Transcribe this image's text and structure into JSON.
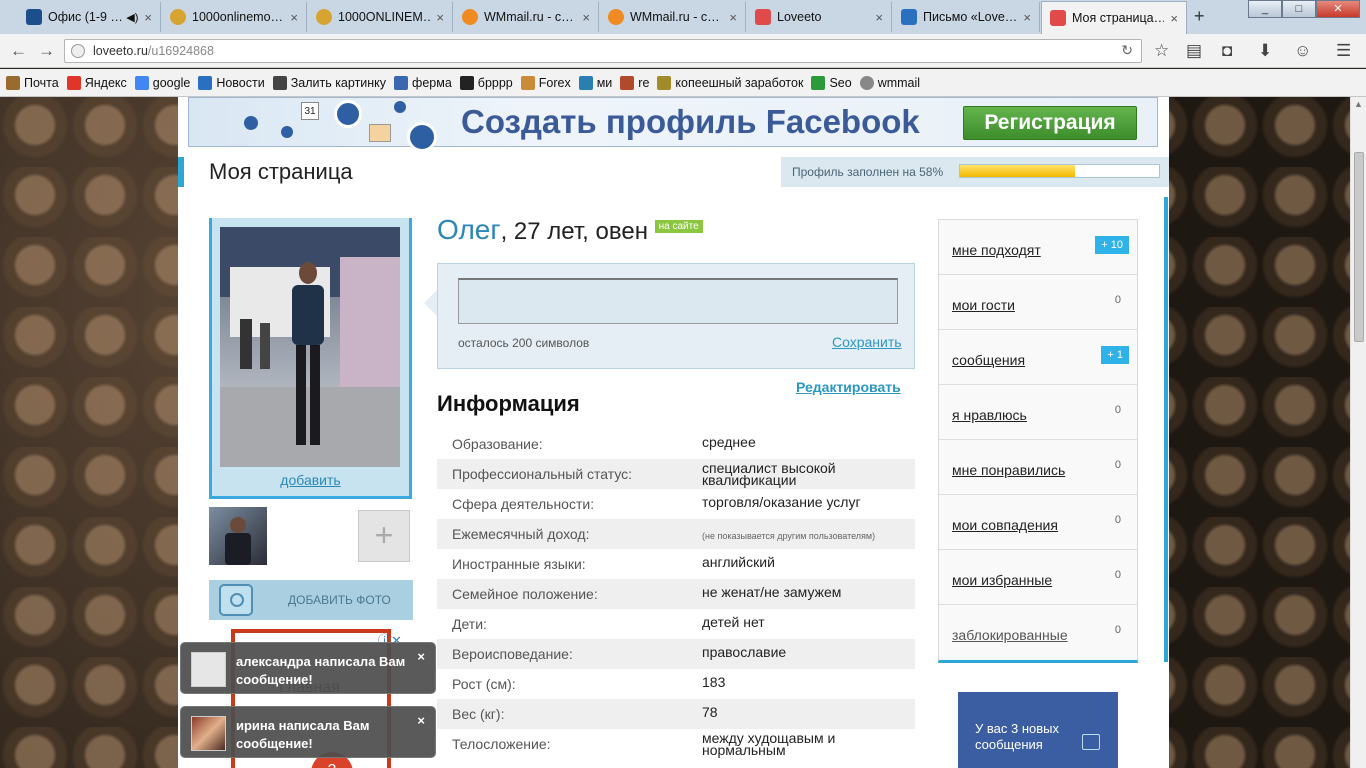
{
  "browser": {
    "tabs": [
      {
        "title": "Офис (1-9 …",
        "favicon_color": "#1b4f8c"
      },
      {
        "title": "1000onlinemo…",
        "favicon_color": "#d8a431"
      },
      {
        "title": "1000ONLINEM…",
        "favicon_color": "#d8a431"
      },
      {
        "title": "WMmail.ru - с…",
        "favicon_color": "#f08a22"
      },
      {
        "title": "WMmail.ru - с…",
        "favicon_color": "#f08a22"
      },
      {
        "title": "Loveeto",
        "favicon_color": "#e04a4a"
      },
      {
        "title": "Письмо «Love…",
        "favicon_color": "#2a6fc0"
      },
      {
        "title": "Моя страница…",
        "favicon_color": "#e04a4a"
      }
    ],
    "close_glyph": "×",
    "new_tab_glyph": "+",
    "url_host": "loveeto.ru",
    "url_path": "/u16924868",
    "bookmarks": [
      {
        "label": "Почта",
        "color": "#9a6b2f"
      },
      {
        "label": "Яндекс",
        "color": "#e0352b"
      },
      {
        "label": "google",
        "color": "#4285f4"
      },
      {
        "label": "Новости",
        "color": "#2a6fc0"
      },
      {
        "label": "Залить картинку",
        "color": "#444"
      },
      {
        "label": "ферма",
        "color": "#3a67b0"
      },
      {
        "label": "брррр",
        "color": "#222"
      },
      {
        "label": "Forex",
        "color": "#c98a3a"
      },
      {
        "label": "ми",
        "color": "#2b7fb0"
      },
      {
        "label": "re",
        "color": "#b04a2a"
      },
      {
        "label": "копеешный заработок",
        "color": "#a28b2a"
      },
      {
        "label": "Seo",
        "color": "#2d9a3a"
      },
      {
        "label": "wmmail",
        "color": "#888"
      }
    ],
    "icons": [
      "back-icon",
      "forward-icon",
      "reload-icon",
      "bookmark-star-icon",
      "reading-list-icon",
      "pocket-icon",
      "download-icon",
      "hello-icon",
      "menu-icon"
    ]
  },
  "ad": {
    "title": "Создать профиль Facebook",
    "button": "Регистрация",
    "calendar_day": "31"
  },
  "page": {
    "title": "Моя страница",
    "profile_filled_label": "Профиль заполнен на 58%",
    "profile_filled_fraction": 0.58
  },
  "left": {
    "add_link": "добавить",
    "add_photo": "ДОБАВИТЬ ФОТО",
    "plus_glyph": "+"
  },
  "user": {
    "name": "Олег",
    "rest": ", 27 лет, овен",
    "online": "на сайте"
  },
  "status": {
    "chars_left": "осталось 200 символов",
    "save": "Сохранить"
  },
  "info": {
    "edit": "Редактировать",
    "header": "Информация",
    "rows": [
      {
        "k": "Образование:",
        "v": "среднее"
      },
      {
        "k": "Профессиональный статус:",
        "v": "специалист высокой квалификации"
      },
      {
        "k": "Сфера деятельности:",
        "v": "торговля/оказание услуг"
      },
      {
        "k": "Ежемесячный доход:",
        "v": "(не показывается другим пользователям)"
      },
      {
        "k": "Иностранные языки:",
        "v": "английский"
      },
      {
        "k": "Семейное положение:",
        "v": "не женат/не замужем"
      },
      {
        "k": "Дети:",
        "v": "детей нет"
      },
      {
        "k": "Вероисповедание:",
        "v": "православие"
      },
      {
        "k": "Рост (см):",
        "v": "183"
      },
      {
        "k": "Вес (кг):",
        "v": "78"
      },
      {
        "k": "Телосложение:",
        "v": "между худощавым и нормальным"
      }
    ]
  },
  "right": {
    "items": [
      {
        "label": "мне подходят",
        "badge": "+ 10"
      },
      {
        "label": "мои гости",
        "count": "0"
      },
      {
        "label": "сообщения",
        "badge": "+ 1"
      },
      {
        "label": "я нравлюсь",
        "count": "0"
      },
      {
        "label": "мне понравились",
        "count": "0"
      },
      {
        "label": "мои совпадения",
        "count": "0"
      },
      {
        "label": "мои избранные",
        "count": "0"
      },
      {
        "label": "заблокированные",
        "count": "0"
      }
    ],
    "new_messages": "У вас 3 новых сообщения"
  },
  "frame_ad": {
    "text": "Главная",
    "ball": "2"
  },
  "notifications": [
    {
      "text": "александра написала Вам сообщение!"
    },
    {
      "text": "ирина написала Вам сообщение!"
    }
  ],
  "colors": {
    "accent": "#2ea6d6",
    "link": "#2c97c4",
    "facebook": "#3b5a98"
  }
}
